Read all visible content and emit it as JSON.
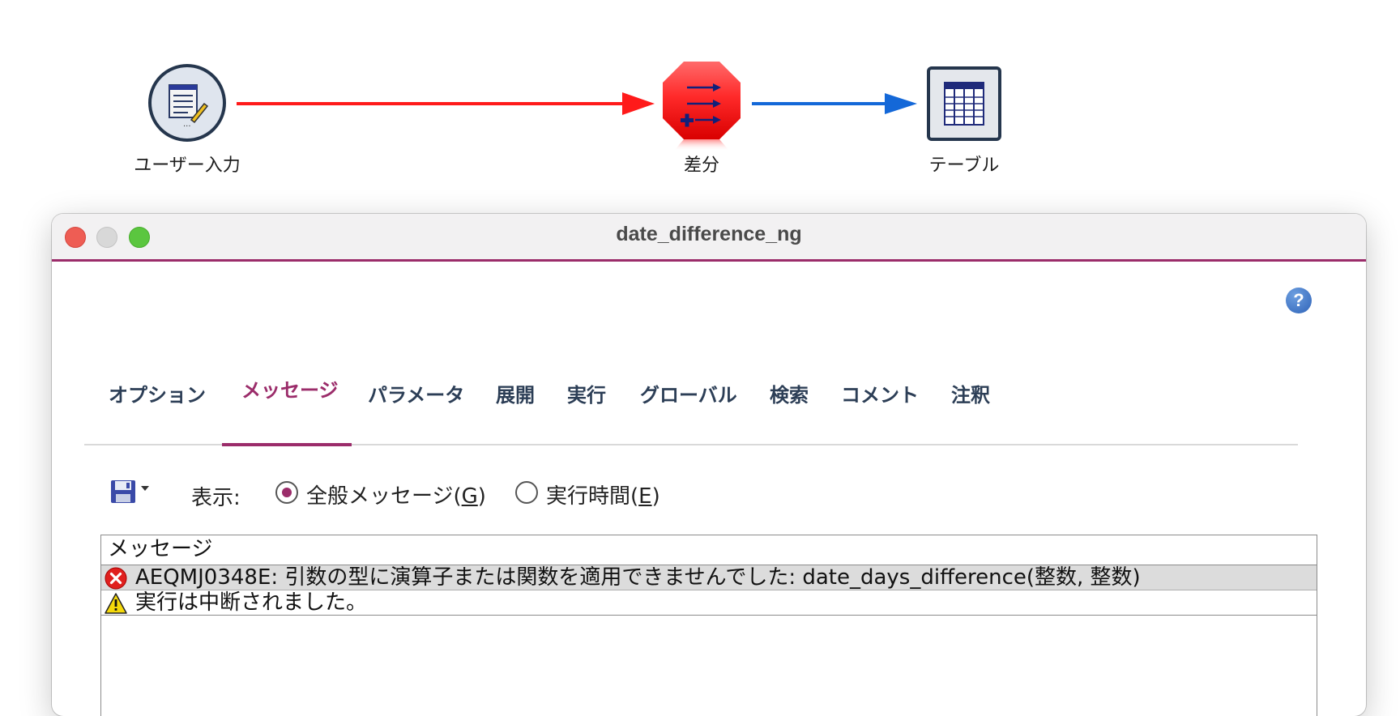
{
  "stream": {
    "nodes": [
      {
        "label": "ユーザー入力",
        "icon": "user-input-icon"
      },
      {
        "label": "差分",
        "icon": "derive-icon"
      },
      {
        "label": "テーブル",
        "icon": "table-icon"
      }
    ],
    "colors": {
      "error_link": "#ff1a1a",
      "normal_link": "#1468d8",
      "derive_node": "#ff2a2a"
    }
  },
  "window": {
    "title": "date_difference_ng",
    "accent": "#9b2c6a",
    "help": "?"
  },
  "tabs": [
    {
      "label": "オプション"
    },
    {
      "label": "メッセージ",
      "active": true
    },
    {
      "label": "パラメータ"
    },
    {
      "label": "展開"
    },
    {
      "label": "実行"
    },
    {
      "label": "グローバル"
    },
    {
      "label": "検索"
    },
    {
      "label": "コメント"
    },
    {
      "label": "注釈"
    }
  ],
  "toolbar": {
    "show_label": "表示:",
    "radio_general_prefix": "全般メッセージ(",
    "radio_general_key": "G",
    "radio_general_suffix": ")",
    "radio_exec_prefix": "実行時間(",
    "radio_exec_key": "E",
    "radio_exec_suffix": ")",
    "selected": "general"
  },
  "messages": {
    "header": "メッセージ",
    "rows": [
      {
        "type": "error",
        "icon": "error-icon",
        "text": "AEQMJ0348E: 引数の型に演算子または関数を適用できませんでした: date_days_difference(整数, 整数)"
      },
      {
        "type": "warning",
        "icon": "warning-icon",
        "text": "実行は中断されました。"
      }
    ]
  }
}
